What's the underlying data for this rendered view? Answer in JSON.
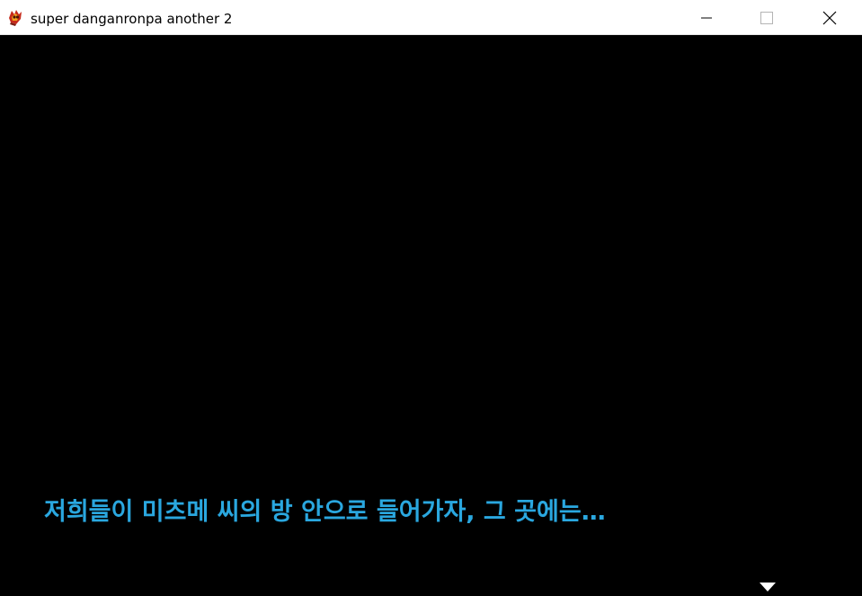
{
  "window": {
    "title": "super danganronpa another 2",
    "icon": "game-app-icon",
    "controls": {
      "minimize": "minimize-icon",
      "maximize": "maximize-icon",
      "close": "close-icon"
    }
  },
  "game": {
    "background_color": "#000000",
    "dialogue_text": "저희들이 미츠메 씨의 방 안으로 들어가자, 그 곳에는…",
    "dialogue_color": "#2aa7df",
    "advance_indicator": "down-triangle-icon"
  }
}
